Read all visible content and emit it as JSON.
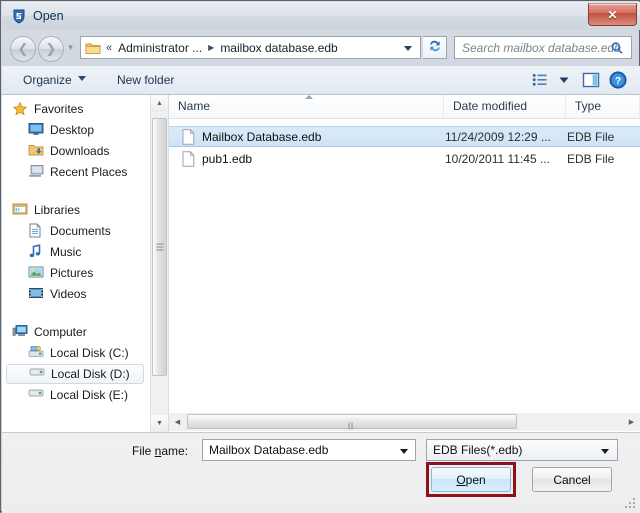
{
  "window": {
    "title": "Open",
    "title_icon": "app-shield-icon",
    "close_label": "✕"
  },
  "nav": {
    "back_icon": "back-arrow-icon",
    "forward_icon": "forward-arrow-icon",
    "history_icon": "chevron-down-icon",
    "address": {
      "folder_icon": "folder-icon",
      "overflow": "«",
      "crumb1": "Administrator ...",
      "separator": "▶",
      "crumb2": "mailbox database.edb",
      "dropdown_icon": "chevron-down-icon"
    },
    "refresh_icon": "refresh-icon",
    "search": {
      "placeholder": "Search mailbox database.edb",
      "icon": "search-icon"
    }
  },
  "toolbar": {
    "organize_label": "Organize",
    "new_folder_label": "New folder",
    "view_icon": "view-list-icon",
    "view_dropdown_icon": "chevron-down-icon",
    "preview_pane_icon": "preview-pane-icon",
    "help_icon": "help-icon"
  },
  "sidebar": {
    "groups": [
      {
        "label": "Favorites",
        "icon": "star-icon",
        "items": [
          {
            "label": "Desktop",
            "icon": "desktop-icon"
          },
          {
            "label": "Downloads",
            "icon": "downloads-icon"
          },
          {
            "label": "Recent Places",
            "icon": "recent-places-icon"
          }
        ]
      },
      {
        "label": "Libraries",
        "icon": "libraries-icon",
        "items": [
          {
            "label": "Documents",
            "icon": "document-icon"
          },
          {
            "label": "Music",
            "icon": "music-icon"
          },
          {
            "label": "Pictures",
            "icon": "pictures-icon"
          },
          {
            "label": "Videos",
            "icon": "videos-icon"
          }
        ]
      },
      {
        "label": "Computer",
        "icon": "computer-icon",
        "items": [
          {
            "label": "Local Disk (C:)",
            "icon": "system-drive-icon"
          },
          {
            "label": "Local Disk (D:)",
            "icon": "drive-icon",
            "hover": true
          },
          {
            "label": "Local Disk (E:)",
            "icon": "drive-icon"
          }
        ]
      }
    ]
  },
  "filelist": {
    "columns": [
      "Name",
      "Date modified",
      "Type"
    ],
    "sort_column": "Name",
    "sort_direction": "ascending",
    "rows": [
      {
        "name": "Mailbox Database.edb",
        "date_modified": "11/24/2009 12:29 ...",
        "type": "EDB File",
        "icon": "file-icon",
        "selected": true
      },
      {
        "name": "pub1.edb",
        "date_modified": "10/20/2011 11:45 ...",
        "type": "EDB File",
        "icon": "file-icon",
        "selected": false
      }
    ]
  },
  "footer": {
    "file_name_label_pre": "File ",
    "file_name_label_key": "n",
    "file_name_label_post": "ame:",
    "file_name_value": "Mailbox Database.edb",
    "filter_value": "EDB Files(*.edb)",
    "open_label_pre": "",
    "open_label_key": "O",
    "open_label_post": "pen",
    "cancel_label": "Cancel"
  },
  "colors": {
    "annotation": "#8c1118",
    "selection": "#cfe3f7",
    "title_text": "#0b2f52"
  }
}
